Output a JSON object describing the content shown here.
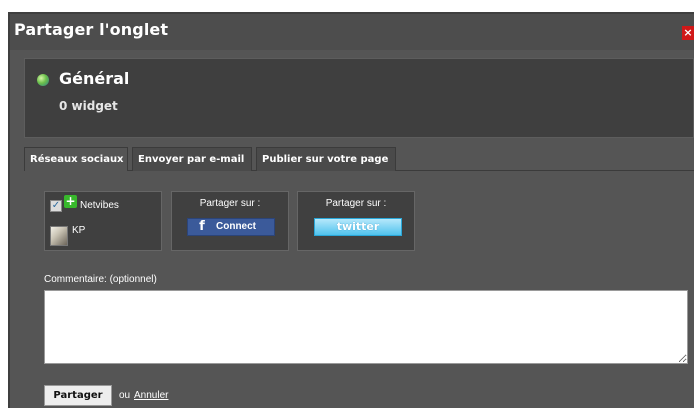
{
  "dialog": {
    "title": "Partager l'onglet",
    "close_label": "×"
  },
  "tab_info": {
    "name": "Général",
    "widget_count": "0 widget",
    "icon": "globe-icon"
  },
  "tabs": [
    {
      "label": "Réseaux sociaux",
      "active": true
    },
    {
      "label": "Envoyer par e-mail",
      "active": false
    },
    {
      "label": "Publier sur votre page",
      "active": false
    }
  ],
  "networks": {
    "checked": true,
    "netvibes_label": "Netvibes",
    "user_label": "KP"
  },
  "share_facebook": {
    "label": "Partager sur :",
    "button_label": "Connect",
    "icon": "f"
  },
  "share_twitter": {
    "label": "Partager sur :",
    "button_label": "twitter"
  },
  "comment": {
    "label": "Commentaire: (optionnel)",
    "value": ""
  },
  "actions": {
    "submit_label": "Partager",
    "or_text": "ou",
    "cancel_label": "Annuler"
  },
  "colors": {
    "background": "#555555",
    "facebook": "#3b5a9a",
    "twitter": "#50c3ee",
    "close": "#d01818"
  }
}
